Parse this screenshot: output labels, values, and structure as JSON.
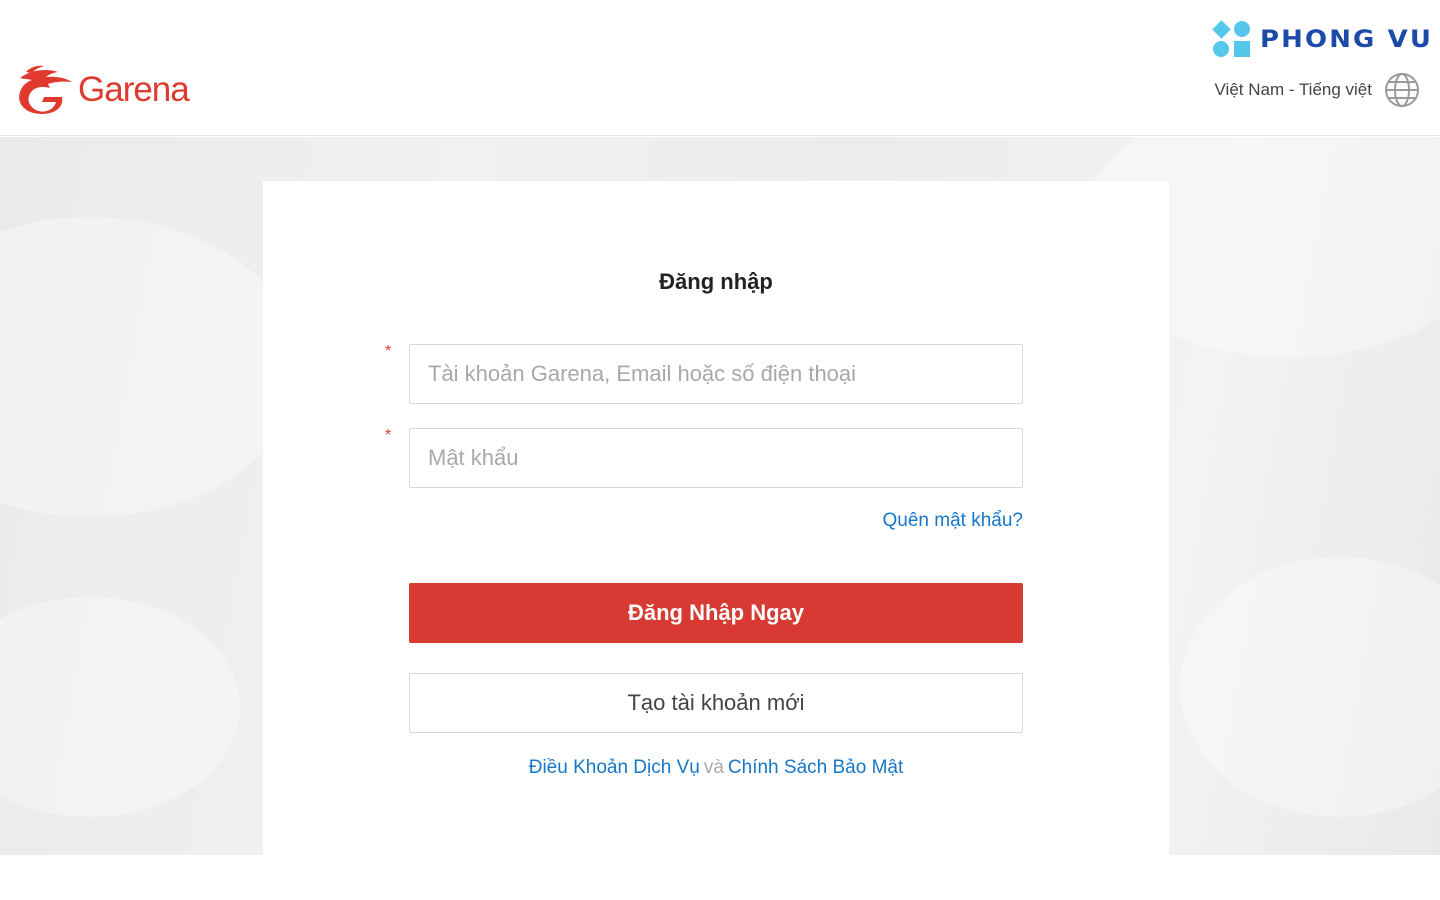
{
  "header": {
    "brand": "Garena",
    "partner_brand": "PHONG VU",
    "language": "Việt Nam - Tiếng việt"
  },
  "login": {
    "title": "Đăng nhập",
    "required_marker": "*",
    "account_placeholder": "Tài khoản Garena, Email hoặc số điện thoại",
    "password_placeholder": "Mật khẩu",
    "forgot_label": "Quên mật khẩu?",
    "submit_label": "Đăng Nhập Ngay",
    "create_label": "Tạo tài khoản mới"
  },
  "footer_links": {
    "terms": "Điều Khoản Dịch Vụ",
    "and": "và",
    "privacy": "Chính Sách Bảo Mật"
  },
  "colors": {
    "brand_red": "#e03a2f",
    "button_red": "#d63a33",
    "link_blue": "#1677c9",
    "partner_blue": "#1b4aa8",
    "partner_cyan": "#55c7ea"
  },
  "icons": [
    "garena-dragon-icon",
    "phong-vu-mark-icon",
    "globe-icon"
  ]
}
